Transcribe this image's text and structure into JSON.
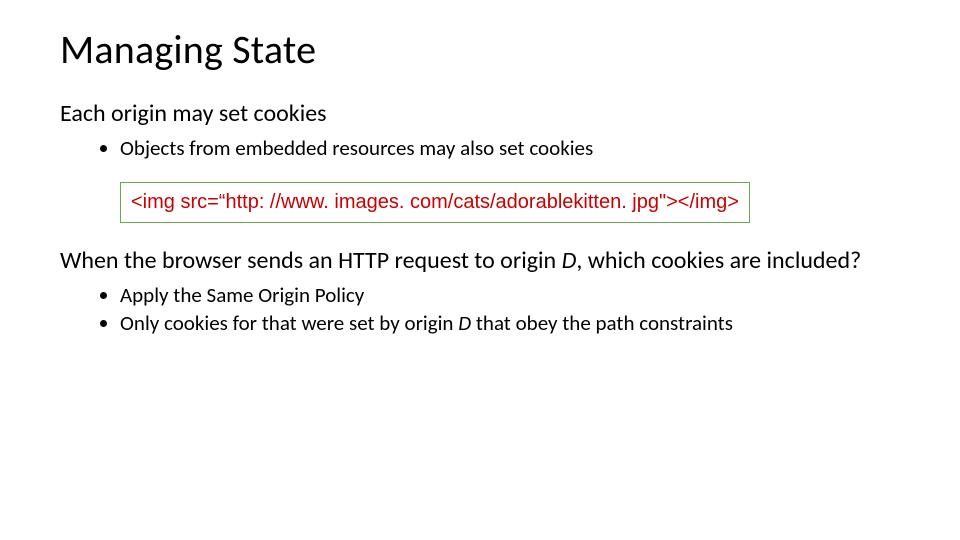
{
  "title": "Managing State",
  "section1": {
    "heading": "Each origin may set cookies",
    "bullet1": "Objects from embedded resources may also set cookies"
  },
  "code": {
    "line": "<img src=“http: //www. images. com/cats/adorablekitten. jpg\"></img>"
  },
  "section2": {
    "line1_pre": "When the browser sends an HTTP request to origin ",
    "line1_var": "D",
    "line1_post": ", which cookies are included?",
    "bullet1": "Apply the Same Origin Policy",
    "bullet2_pre": "Only cookies for that were set by origin ",
    "bullet2_var": "D",
    "bullet2_post": " that obey the path constraints"
  }
}
